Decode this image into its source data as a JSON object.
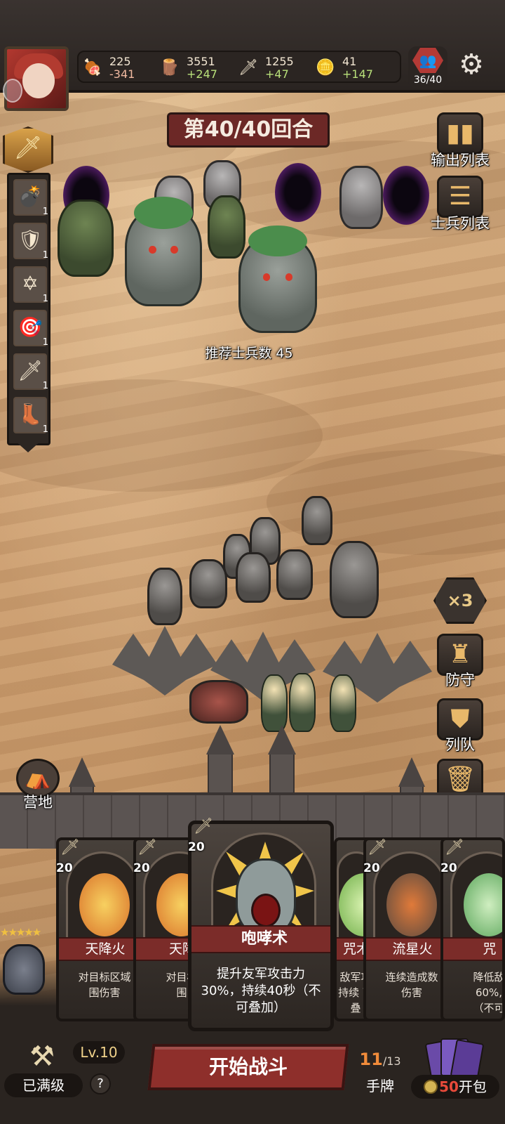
{
  "resources": [
    {
      "icon": "meat-icon",
      "glyph": "🍖",
      "value": "225",
      "delta": "-341",
      "sign": "neg"
    },
    {
      "icon": "wood-icon",
      "glyph": "🪵",
      "value": "3551",
      "delta": "+247",
      "sign": "pos"
    },
    {
      "icon": "sword-icon",
      "glyph": "🗡",
      "value": "1255",
      "delta": "+47",
      "sign": "pos"
    },
    {
      "icon": "coin-icon",
      "glyph": "🪙",
      "value": "41",
      "delta": "+147",
      "sign": "pos"
    }
  ],
  "population": {
    "count": "36/40"
  },
  "round": {
    "label": "第40/40回合"
  },
  "skills": [
    {
      "icon": "cannon-icon",
      "glyph": "💣",
      "count": "1"
    },
    {
      "icon": "shield-icon",
      "glyph": "🛡",
      "count": "1"
    },
    {
      "icon": "pentagram-icon",
      "glyph": "✡",
      "count": "1"
    },
    {
      "icon": "target-icon",
      "glyph": "🎯",
      "count": "1"
    },
    {
      "icon": "flaming-sword-icon",
      "glyph": "🗡",
      "count": "1"
    },
    {
      "icon": "boots-icon",
      "glyph": "👢",
      "count": "1"
    }
  ],
  "right_menu": {
    "output_list": "输出列表",
    "soldier_list": "士兵列表",
    "speed": "×3",
    "defend": "防守",
    "formation": "列队",
    "discard": "弃牌"
  },
  "recommend": "推荐士兵数 45",
  "camp": "营地",
  "cards": [
    {
      "cost": "20",
      "name": "天降火",
      "desc": "对目标区域\n围伤害",
      "art": "#d9722a"
    },
    {
      "cost": "20",
      "name": "天降",
      "desc": "对目标\n围",
      "art": "#d9722a"
    },
    {
      "cost": "20",
      "name": "咆哮术",
      "desc": "提升友军攻击力30%，持续40秒（不可叠加）",
      "art": "#f0c54a"
    },
    {
      "cost": "",
      "name": "咒术",
      "desc": "敌军攻\n持续\n可叠",
      "art": "#9ccf6e"
    },
    {
      "cost": "20",
      "name": "流星火",
      "desc": "连续造成数\n伤害",
      "art": "#a05a2e"
    },
    {
      "cost": "20",
      "name": "咒",
      "desc": "降低敌\n60%,\n（不可",
      "art": "#6fbf6a"
    }
  ],
  "hero": {
    "stars": "★★★★★"
  },
  "bottom": {
    "level": "Lv.10",
    "maxed": "已满级",
    "help": "?",
    "start": "开始战斗",
    "hand_current": "11",
    "hand_total": "/13",
    "hand_label": "手牌",
    "pack_price": "50",
    "pack_label": "开包"
  }
}
